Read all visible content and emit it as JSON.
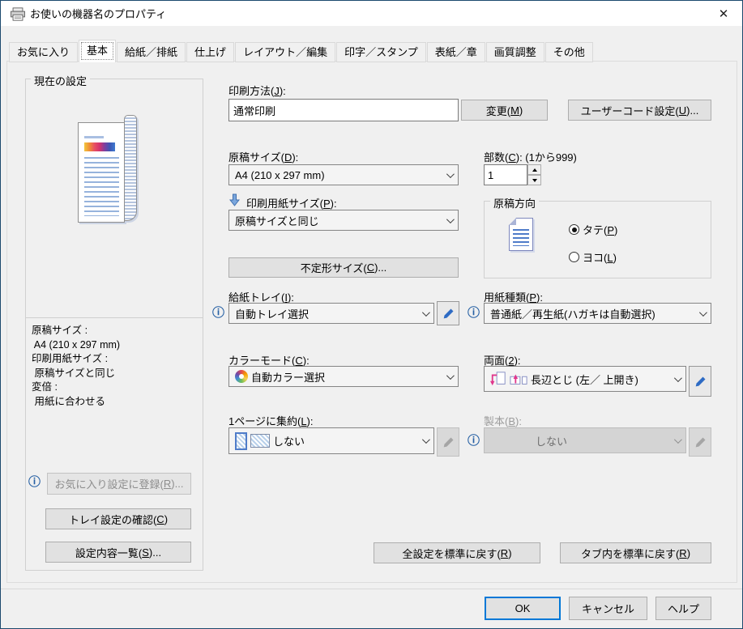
{
  "window": {
    "title": "お使いの機器名のプロパティ",
    "close_glyph": "✕"
  },
  "tabs": [
    {
      "label": "お気に入り",
      "active": false
    },
    {
      "label": "基本",
      "active": true
    },
    {
      "label": "給紙／排紙",
      "active": false
    },
    {
      "label": "仕上げ",
      "active": false
    },
    {
      "label": "レイアウト／編集",
      "active": false
    },
    {
      "label": "印字／スタンプ",
      "active": false
    },
    {
      "label": "表紙／章",
      "active": false
    },
    {
      "label": "画質調整",
      "active": false
    },
    {
      "label": "その他",
      "active": false
    }
  ],
  "left_panel": {
    "group_title": "現在の設定",
    "summary_lines": [
      "原稿サイズ :",
      " A4 (210 x 297 mm)",
      "印刷用紙サイズ :",
      " 原稿サイズと同じ",
      "変倍 :",
      " 用紙に合わせる"
    ],
    "register_button": "お気に入り設定に登録(R)...",
    "tray_check_button": "トレイ設定の確認(C)",
    "settings_list_button": "設定内容一覧(S)..."
  },
  "main": {
    "print_method": {
      "label": "印刷方法(J):",
      "value": "通常印刷",
      "change_button": "変更(M)",
      "user_code_button": "ユーザーコード設定(U)..."
    },
    "original_size": {
      "label": "原稿サイズ(D):",
      "value": "A4 (210 x 297 mm)"
    },
    "copies": {
      "label": "部数(C): (1から999)",
      "value": "1"
    },
    "print_paper_size": {
      "label": "印刷用紙サイズ(P):",
      "value": "原稿サイズと同じ"
    },
    "orientation": {
      "group_title": "原稿方向",
      "portrait_label": "タテ(P)",
      "landscape_label": "ヨコ(L)",
      "selected": "portrait"
    },
    "custom_size_button": "不定形サイズ(C)...",
    "input_tray": {
      "label": "給紙トレイ(I):",
      "value": "自動トレイ選択"
    },
    "paper_type": {
      "label": "用紙種類(P):",
      "value": "普通紙／再生紙(ハガキは自動選択)"
    },
    "color_mode": {
      "label": "カラーモード(C):",
      "value": "自動カラー選択"
    },
    "duplex": {
      "label": "両面(2):",
      "value": "長辺とじ (左／ 上開き)"
    },
    "combine": {
      "label": "1ページに集約(L):",
      "value": "しない"
    },
    "booklet": {
      "label": "製本(B):",
      "value": "しない",
      "disabled": true
    },
    "reset_all_button": "全設定を標準に戻す(R)",
    "reset_tab_button": "タブ内を標準に戻す(R)"
  },
  "footer": {
    "ok": "OK",
    "cancel": "キャンセル",
    "help": "ヘルプ"
  },
  "colors": {
    "accent": "#0078d7",
    "dialog_bg": "#f0f0f0",
    "title_bar": "#ffffff",
    "info_icon": "#2660a4",
    "pencil_icon": "#2e6bc4",
    "window_border": "#1c4a6e"
  },
  "icons": {
    "close": "✕",
    "info": "ⓘ"
  }
}
